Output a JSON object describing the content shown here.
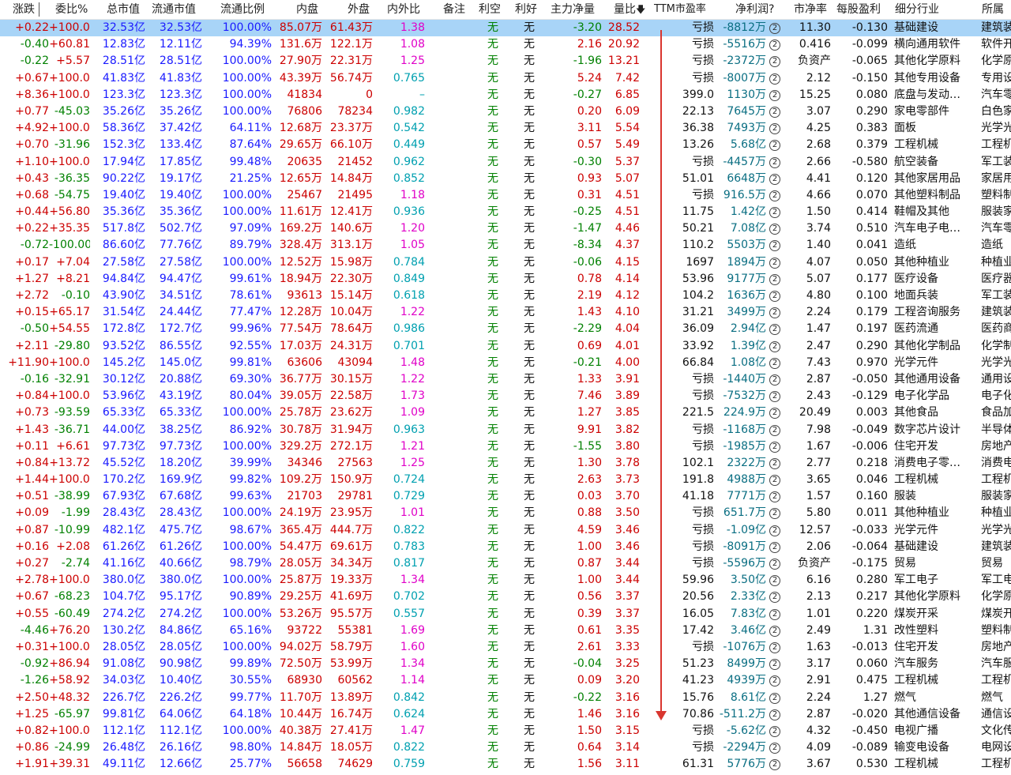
{
  "header": {
    "zhangdie": "涨跌",
    "weibi": "委比%",
    "zongshizhi": "总市值",
    "liutongshizhi": "流通市值",
    "liutongbili": "流通比例",
    "neipan": "内盘",
    "waipan": "外盘",
    "neiwaibi": "内外比",
    "beizhu": "备注",
    "likong": "利空",
    "lihao": "利好",
    "zhulijingliang": "主力净量",
    "liangbi": "量比",
    "ttm": "TTM市盈率",
    "jinglirun": "净利润?",
    "shijinglv": "市净率",
    "meigu": "每股盈利",
    "hangye": "细分行业",
    "suoshu": "所属"
  },
  "sort_indicator": "🡇",
  "none_label": "无",
  "rows": [
    [
      "+0.22",
      "+100.00",
      "32.53亿",
      "32.53亿",
      "100.00%",
      "85.07万",
      "61.43万",
      "1.38",
      "无",
      "无",
      "-3.20",
      "28.52",
      "亏损",
      "-8812万",
      "11.30",
      "-0.130",
      "基础建设",
      "建筑装"
    ],
    [
      "-0.40",
      "+60.81",
      "12.83亿",
      "12.11亿",
      "94.39%",
      "131.6万",
      "122.1万",
      "1.08",
      "无",
      "无",
      "2.16",
      "20.92",
      "亏损",
      "-5516万",
      "0.416",
      "-0.099",
      "横向通用软件",
      "软件开"
    ],
    [
      "-0.22",
      "+5.57",
      "28.51亿",
      "28.51亿",
      "100.00%",
      "27.90万",
      "22.31万",
      "1.25",
      "无",
      "无",
      "-1.96",
      "13.21",
      "亏损",
      "-2372万",
      "负资产",
      "-0.065",
      "其他化学原料",
      "化学原"
    ],
    [
      "+0.67",
      "+100.00",
      "41.83亿",
      "41.83亿",
      "100.00%",
      "43.39万",
      "56.74万",
      "0.765",
      "无",
      "无",
      "5.24",
      "7.42",
      "亏损",
      "-8007万",
      "2.12",
      "-0.150",
      "其他专用设备",
      "专用设"
    ],
    [
      "+8.36",
      "+100.00",
      "123.3亿",
      "123.3亿",
      "100.00%",
      "41834",
      "0",
      "–",
      "无",
      "无",
      "-0.27",
      "6.85",
      "399.0",
      "1130万",
      "15.25",
      "0.080",
      "底盘与发动…",
      "汽车零"
    ],
    [
      "+0.77",
      "-45.03",
      "35.26亿",
      "35.26亿",
      "100.00%",
      "76806",
      "78234",
      "0.982",
      "无",
      "无",
      "0.20",
      "6.09",
      "22.13",
      "7645万",
      "3.07",
      "0.290",
      "家电零部件",
      "白色家"
    ],
    [
      "+4.92",
      "+100.00",
      "58.36亿",
      "37.42亿",
      "64.11%",
      "12.68万",
      "23.37万",
      "0.542",
      "无",
      "无",
      "3.11",
      "5.54",
      "36.38",
      "7493万",
      "4.25",
      "0.383",
      "面板",
      "光学光"
    ],
    [
      "+0.70",
      "-31.96",
      "152.3亿",
      "133.4亿",
      "87.64%",
      "29.65万",
      "66.10万",
      "0.449",
      "无",
      "无",
      "0.57",
      "5.49",
      "13.26",
      "5.68亿",
      "2.68",
      "0.379",
      "工程机械",
      "工程机"
    ],
    [
      "+1.10",
      "+100.00",
      "17.94亿",
      "17.85亿",
      "99.48%",
      "20635",
      "21452",
      "0.962",
      "无",
      "无",
      "-0.30",
      "5.37",
      "亏损",
      "-4457万",
      "2.66",
      "-0.580",
      "航空装备",
      "军工装"
    ],
    [
      "+0.43",
      "-36.35",
      "90.22亿",
      "19.17亿",
      "21.25%",
      "12.65万",
      "14.84万",
      "0.852",
      "无",
      "无",
      "0.93",
      "5.07",
      "51.01",
      "6648万",
      "4.41",
      "0.120",
      "其他家居用品",
      "家居用"
    ],
    [
      "+0.68",
      "-54.75",
      "19.40亿",
      "19.40亿",
      "100.00%",
      "25467",
      "21495",
      "1.18",
      "无",
      "无",
      "0.31",
      "4.51",
      "亏损",
      "916.5万",
      "4.66",
      "0.070",
      "其他塑料制品",
      "塑料制"
    ],
    [
      "+0.44",
      "+56.80",
      "35.36亿",
      "35.36亿",
      "100.00%",
      "11.61万",
      "12.41万",
      "0.936",
      "无",
      "无",
      "-0.25",
      "4.51",
      "11.75",
      "1.42亿",
      "1.50",
      "0.414",
      "鞋帽及其他",
      "服装家"
    ],
    [
      "+0.22",
      "+35.35",
      "517.8亿",
      "502.7亿",
      "97.09%",
      "169.2万",
      "140.6万",
      "1.20",
      "无",
      "无",
      "-1.47",
      "4.46",
      "50.21",
      "7.08亿",
      "3.74",
      "0.510",
      "汽车电子电…",
      "汽车零"
    ],
    [
      "-0.72",
      "-100.00",
      "86.60亿",
      "77.76亿",
      "89.79%",
      "328.4万",
      "313.1万",
      "1.05",
      "无",
      "无",
      "-8.34",
      "4.37",
      "110.2",
      "5503万",
      "1.40",
      "0.041",
      "造纸",
      "造纸"
    ],
    [
      "+0.17",
      "+7.04",
      "27.58亿",
      "27.58亿",
      "100.00%",
      "12.52万",
      "15.98万",
      "0.784",
      "无",
      "无",
      "-0.06",
      "4.15",
      "1697",
      "1894万",
      "4.07",
      "0.050",
      "其他种植业",
      "种植业"
    ],
    [
      "+1.27",
      "+8.21",
      "94.84亿",
      "94.47亿",
      "99.61%",
      "18.94万",
      "22.30万",
      "0.849",
      "无",
      "无",
      "0.78",
      "4.14",
      "53.96",
      "9177万",
      "5.07",
      "0.177",
      "医疗设备",
      "医疗器"
    ],
    [
      "+2.72",
      "-0.10",
      "43.90亿",
      "34.51亿",
      "78.61%",
      "93613",
      "15.14万",
      "0.618",
      "无",
      "无",
      "2.19",
      "4.12",
      "104.2",
      "1636万",
      "4.80",
      "0.100",
      "地面兵装",
      "军工装"
    ],
    [
      "+0.15",
      "+65.17",
      "31.54亿",
      "24.44亿",
      "77.47%",
      "12.28万",
      "10.04万",
      "1.22",
      "无",
      "无",
      "1.43",
      "4.10",
      "31.21",
      "3499万",
      "2.24",
      "0.179",
      "工程咨询服务",
      "建筑装"
    ],
    [
      "-0.50",
      "+54.55",
      "172.8亿",
      "172.7亿",
      "99.96%",
      "77.54万",
      "78.64万",
      "0.986",
      "无",
      "无",
      "-2.29",
      "4.04",
      "36.09",
      "2.94亿",
      "1.47",
      "0.197",
      "医药流通",
      "医药商"
    ],
    [
      "+2.11",
      "-29.80",
      "93.52亿",
      "86.55亿",
      "92.55%",
      "17.03万",
      "24.31万",
      "0.701",
      "无",
      "无",
      "0.69",
      "4.01",
      "33.92",
      "1.39亿",
      "2.47",
      "0.290",
      "其他化学制品",
      "化学制"
    ],
    [
      "+11.90",
      "+100.00",
      "145.2亿",
      "145.0亿",
      "99.81%",
      "63606",
      "43094",
      "1.48",
      "无",
      "无",
      "-0.21",
      "4.00",
      "66.84",
      "1.08亿",
      "7.43",
      "0.970",
      "光学元件",
      "光学光"
    ],
    [
      "-0.16",
      "-32.91",
      "30.12亿",
      "20.88亿",
      "69.30%",
      "36.77万",
      "30.15万",
      "1.22",
      "无",
      "无",
      "1.33",
      "3.91",
      "亏损",
      "-1440万",
      "2.87",
      "-0.050",
      "其他通用设备",
      "通用设"
    ],
    [
      "+0.84",
      "+100.00",
      "53.96亿",
      "43.19亿",
      "80.04%",
      "39.05万",
      "22.58万",
      "1.73",
      "无",
      "无",
      "7.46",
      "3.89",
      "亏损",
      "-7532万",
      "2.43",
      "-0.129",
      "电子化学品",
      "电子化"
    ],
    [
      "+0.73",
      "-93.59",
      "65.33亿",
      "65.33亿",
      "100.00%",
      "25.78万",
      "23.62万",
      "1.09",
      "无",
      "无",
      "1.27",
      "3.85",
      "221.5",
      "224.9万",
      "20.49",
      "0.003",
      "其他食品",
      "食品加"
    ],
    [
      "+1.43",
      "-36.71",
      "44.00亿",
      "38.25亿",
      "86.92%",
      "30.78万",
      "31.94万",
      "0.963",
      "无",
      "无",
      "9.91",
      "3.82",
      "亏损",
      "-1168万",
      "7.98",
      "-0.049",
      "数字芯片设计",
      "半导体"
    ],
    [
      "+0.11",
      "+6.61",
      "97.73亿",
      "97.73亿",
      "100.00%",
      "329.2万",
      "272.1万",
      "1.21",
      "无",
      "无",
      "-1.55",
      "3.80",
      "亏损",
      "-1985万",
      "1.67",
      "-0.006",
      "住宅开发",
      "房地产"
    ],
    [
      "+0.84",
      "+13.72",
      "45.52亿",
      "18.20亿",
      "39.99%",
      "34346",
      "27563",
      "1.25",
      "无",
      "无",
      "1.30",
      "3.78",
      "102.1",
      "2322万",
      "2.77",
      "0.218",
      "消费电子零…",
      "消费电"
    ],
    [
      "+1.44",
      "+100.00",
      "170.2亿",
      "169.9亿",
      "99.82%",
      "109.2万",
      "150.9万",
      "0.724",
      "无",
      "无",
      "2.63",
      "3.73",
      "191.8",
      "4988万",
      "3.65",
      "0.046",
      "工程机械",
      "工程机"
    ],
    [
      "+0.51",
      "-38.99",
      "67.93亿",
      "67.68亿",
      "99.63%",
      "21703",
      "29781",
      "0.729",
      "无",
      "无",
      "0.03",
      "3.70",
      "41.18",
      "7771万",
      "1.57",
      "0.160",
      "服装",
      "服装家"
    ],
    [
      "+0.09",
      "-1.99",
      "28.43亿",
      "28.43亿",
      "100.00%",
      "24.19万",
      "23.95万",
      "1.01",
      "无",
      "无",
      "0.88",
      "3.50",
      "亏损",
      "651.7万",
      "5.80",
      "0.011",
      "其他种植业",
      "种植业"
    ],
    [
      "+0.87",
      "-10.99",
      "482.1亿",
      "475.7亿",
      "98.67%",
      "365.4万",
      "444.7万",
      "0.822",
      "无",
      "无",
      "4.59",
      "3.46",
      "亏损",
      "-1.09亿",
      "12.57",
      "-0.033",
      "光学元件",
      "光学光"
    ],
    [
      "+0.16",
      "+2.08",
      "61.26亿",
      "61.26亿",
      "100.00%",
      "54.47万",
      "69.61万",
      "0.783",
      "无",
      "无",
      "1.00",
      "3.46",
      "亏损",
      "-8091万",
      "2.06",
      "-0.064",
      "基础建设",
      "建筑装"
    ],
    [
      "+0.27",
      "-2.74",
      "41.16亿",
      "40.66亿",
      "98.79%",
      "28.05万",
      "34.34万",
      "0.817",
      "无",
      "无",
      "0.87",
      "3.44",
      "亏损",
      "-5596万",
      "负资产",
      "-0.175",
      "贸易",
      "贸易"
    ],
    [
      "+2.78",
      "+100.00",
      "380.0亿",
      "380.0亿",
      "100.00%",
      "25.87万",
      "19.33万",
      "1.34",
      "无",
      "无",
      "1.00",
      "3.44",
      "59.96",
      "3.50亿",
      "6.16",
      "0.280",
      "军工电子",
      "军工电"
    ],
    [
      "+0.67",
      "-68.23",
      "104.7亿",
      "95.17亿",
      "90.89%",
      "29.25万",
      "41.69万",
      "0.702",
      "无",
      "无",
      "0.56",
      "3.37",
      "20.56",
      "2.33亿",
      "2.13",
      "0.217",
      "其他化学原料",
      "化学原"
    ],
    [
      "+0.55",
      "-60.49",
      "274.2亿",
      "274.2亿",
      "100.00%",
      "53.26万",
      "95.57万",
      "0.557",
      "无",
      "无",
      "0.39",
      "3.37",
      "16.05",
      "7.83亿",
      "1.01",
      "0.220",
      "煤炭开采",
      "煤炭开"
    ],
    [
      "-4.46",
      "+76.20",
      "130.2亿",
      "84.86亿",
      "65.16%",
      "93722",
      "55381",
      "1.69",
      "无",
      "无",
      "0.61",
      "3.35",
      "17.42",
      "3.46亿",
      "2.49",
      "1.31",
      "改性塑料",
      "塑料制"
    ],
    [
      "+0.31",
      "+100.00",
      "28.05亿",
      "28.05亿",
      "100.00%",
      "94.02万",
      "58.79万",
      "1.60",
      "无",
      "无",
      "2.61",
      "3.33",
      "亏损",
      "-1076万",
      "1.63",
      "-0.013",
      "住宅开发",
      "房地产"
    ],
    [
      "-0.92",
      "+86.94",
      "91.08亿",
      "90.98亿",
      "99.89%",
      "72.50万",
      "53.99万",
      "1.34",
      "无",
      "无",
      "-0.04",
      "3.25",
      "51.23",
      "8499万",
      "3.17",
      "0.060",
      "汽车服务",
      "汽车服"
    ],
    [
      "-1.26",
      "+58.92",
      "34.03亿",
      "10.40亿",
      "30.55%",
      "68930",
      "60562",
      "1.14",
      "无",
      "无",
      "0.09",
      "3.20",
      "41.23",
      "4939万",
      "2.91",
      "0.475",
      "工程机械",
      "工程机"
    ],
    [
      "+2.50",
      "+48.32",
      "226.7亿",
      "226.2亿",
      "99.77%",
      "11.70万",
      "13.89万",
      "0.842",
      "无",
      "无",
      "-0.22",
      "3.16",
      "15.76",
      "8.61亿",
      "2.24",
      "1.27",
      "燃气",
      "燃气"
    ],
    [
      "+1.25",
      "-65.97",
      "99.81亿",
      "64.06亿",
      "64.18%",
      "10.44万",
      "16.74万",
      "0.624",
      "无",
      "无",
      "1.46",
      "3.16",
      "70.86",
      "-511.2万",
      "2.87",
      "-0.020",
      "其他通信设备",
      "通信设"
    ],
    [
      "+0.82",
      "+100.00",
      "112.1亿",
      "112.1亿",
      "100.00%",
      "40.38万",
      "27.41万",
      "1.47",
      "无",
      "无",
      "1.50",
      "3.15",
      "亏损",
      "-5.62亿",
      "4.32",
      "-0.450",
      "电视广播",
      "文化传"
    ],
    [
      "+0.86",
      "-24.99",
      "26.48亿",
      "26.16亿",
      "98.80%",
      "14.84万",
      "18.05万",
      "0.822",
      "无",
      "无",
      "0.64",
      "3.14",
      "亏损",
      "-2294万",
      "4.09",
      "-0.089",
      "输变电设备",
      "电网设"
    ],
    [
      "+1.91",
      "+39.31",
      "49.11亿",
      "12.66亿",
      "25.77%",
      "56658",
      "74629",
      "0.759",
      "无",
      "无",
      "1.56",
      "3.11",
      "61.31",
      "5776万",
      "3.67",
      "0.530",
      "工程机械",
      "工程机"
    ]
  ],
  "colors": {
    "up": "#cc0000",
    "down": "#008000",
    "selected_row": "#a8d4f7",
    "annotation_arrow": "#d9362f"
  }
}
